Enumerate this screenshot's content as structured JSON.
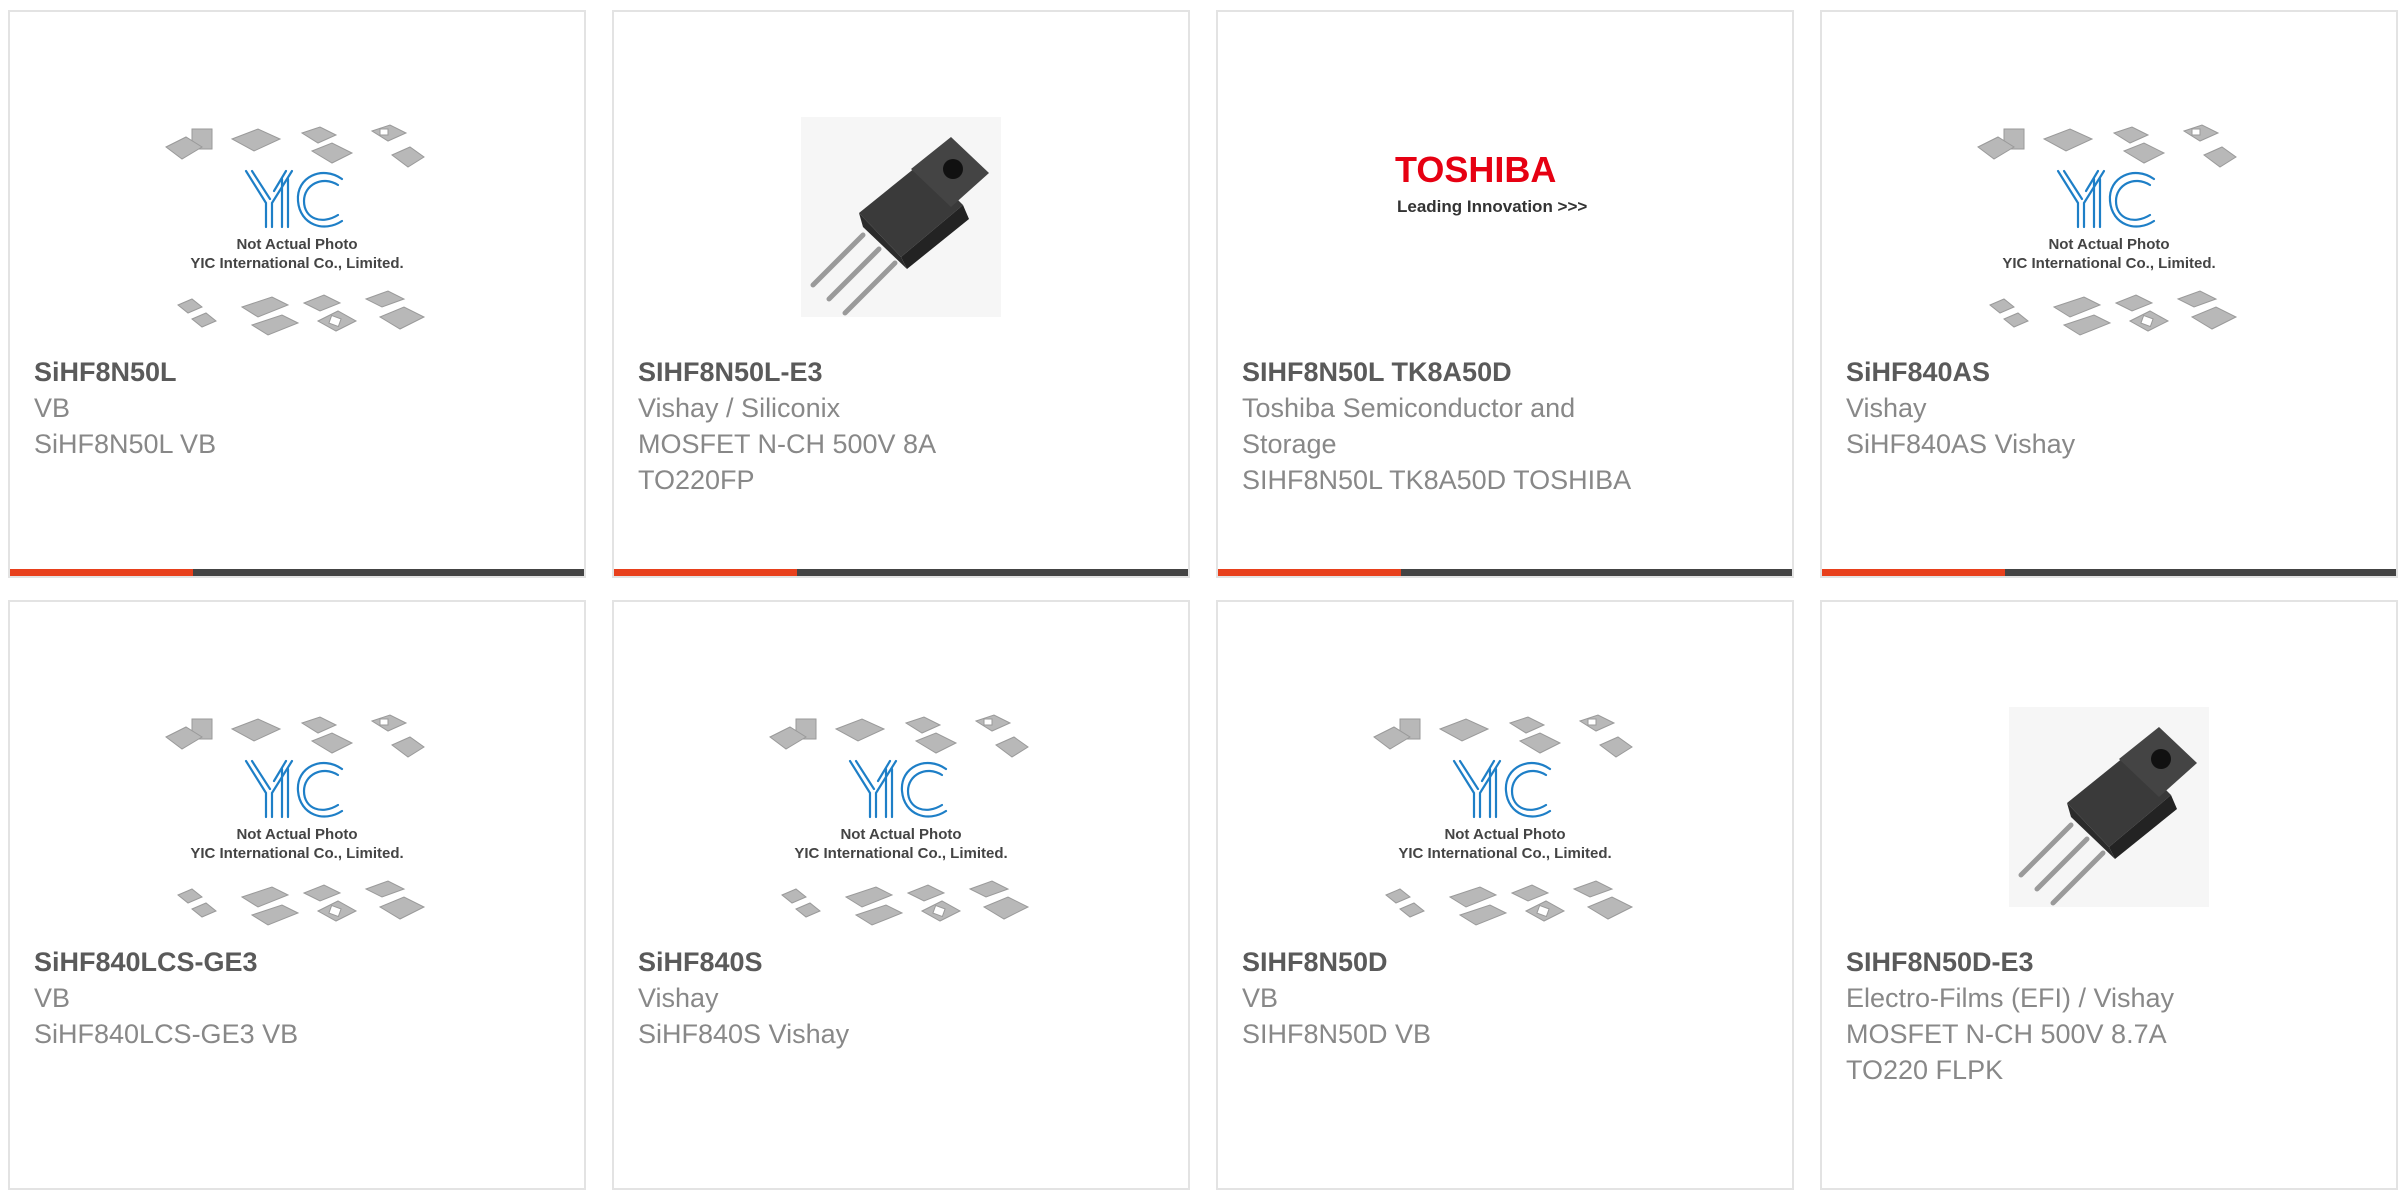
{
  "colors": {
    "accent": "#e8401c",
    "bar": "#444444",
    "border": "#e3e3e3",
    "title": "#5a5a5a",
    "text": "#888888",
    "yic_blue": "#1e7fc7",
    "toshiba_red": "#e60012"
  },
  "placeholder": {
    "line1": "Not Actual Photo",
    "line2": "YIC International Co., Limited.",
    "logo": "YIC"
  },
  "toshiba": {
    "brand": "TOSHIBA",
    "tagline": "Leading Innovation >>>"
  },
  "products": [
    {
      "image": "yic-placeholder-icon",
      "name": "SiHF8N50L",
      "manufacturer": "VB",
      "description": "SiHF8N50L VB"
    },
    {
      "image": "mosfet-to220fp-icon",
      "name": "SIHF8N50L-E3",
      "manufacturer": "Vishay / Siliconix",
      "description": "MOSFET N-CH 500V 8A\nTO220FP"
    },
    {
      "image": "toshiba-logo-icon",
      "name": "SIHF8N50L TK8A50D",
      "manufacturer": "Toshiba Semiconductor and\nStorage",
      "description": "SIHF8N50L TK8A50D TOSHIBA"
    },
    {
      "image": "yic-placeholder-icon",
      "name": "SiHF840AS",
      "manufacturer": "Vishay",
      "description": "SiHF840AS Vishay"
    },
    {
      "image": "yic-placeholder-icon",
      "name": "SiHF840LCS-GE3",
      "manufacturer": "VB",
      "description": "SiHF840LCS-GE3 VB"
    },
    {
      "image": "yic-placeholder-icon",
      "name": "SiHF840S",
      "manufacturer": "Vishay",
      "description": "SiHF840S Vishay"
    },
    {
      "image": "yic-placeholder-icon",
      "name": "SIHF8N50D",
      "manufacturer": "VB",
      "description": "SIHF8N50D VB"
    },
    {
      "image": "mosfet-to220fp-icon",
      "name": "SIHF8N50D-E3",
      "manufacturer": "Electro-Films (EFI) / Vishay",
      "description": "MOSFET N-CH 500V 8.7A\nTO220 FLPK"
    }
  ]
}
